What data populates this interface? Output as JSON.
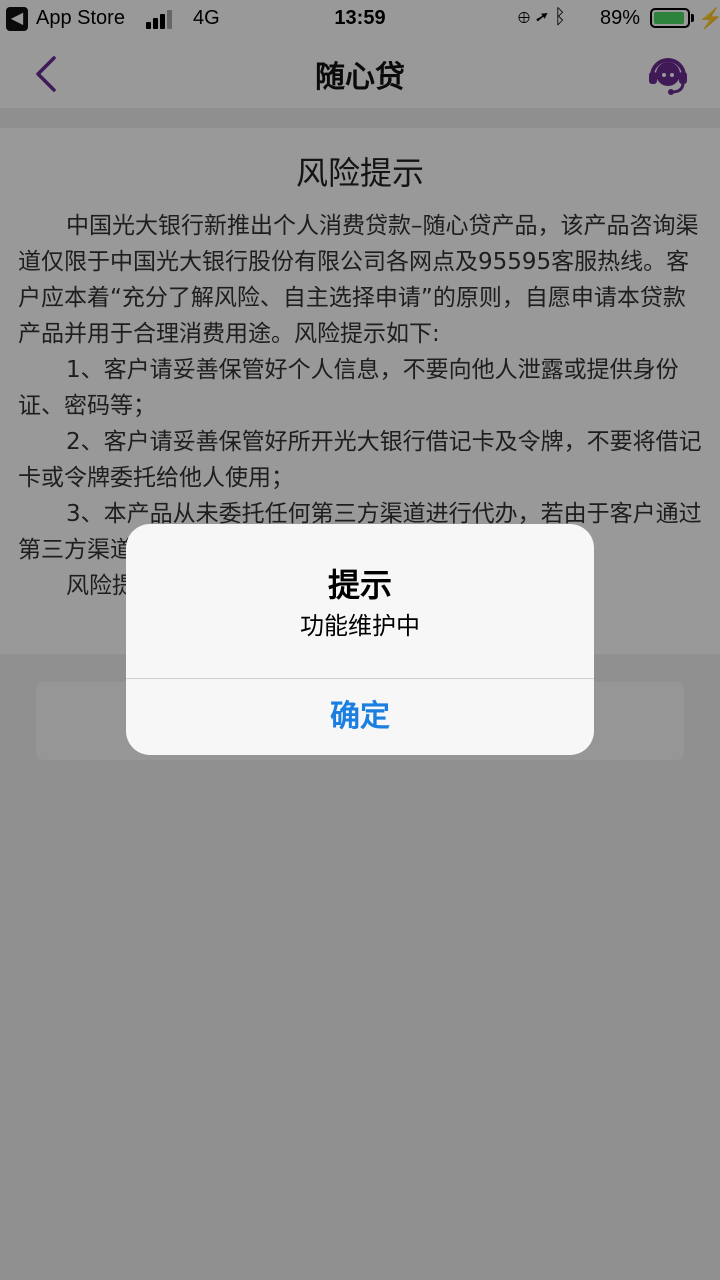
{
  "status_bar": {
    "back_app_label": "App Store",
    "network": "4G",
    "time": "13:59",
    "battery_percent": "89%",
    "battery_level": 0.89,
    "icons": [
      "orientation-lock-icon",
      "location-icon",
      "bluetooth-icon",
      "battery-icon",
      "charging-icon"
    ]
  },
  "nav": {
    "title": "随心贷",
    "accent_color": "#6b2c91"
  },
  "content": {
    "heading": "风险提示",
    "paragraphs": [
      "中国光大银行新推出个人消费贷款–随心贷产品，该产品咨询渠道仅限于中国光大银行股份有限公司各网点及95595客服热线。客户应本着“充分了解风险、自主选择申请”的原则，自愿申请本贷款产品并用于合理消费用途。风险提示如下:",
      "1、客户请妥善保管好个人信息，不要向他人泄露或提供身份证、密码等；",
      "2、客户请妥善保管好所开光大银行借记卡及令牌，不要将借记卡或令牌委托给他人使用；",
      "3、本产品从未委托任何第三方渠道进行代办，若由于客户通过第三方渠道办理产生的任何风险，由客户自行承担。",
      "风险提示"
    ]
  },
  "alert": {
    "title": "提示",
    "message": "功能维护中",
    "confirm_label": "确定",
    "confirm_color": "#1a7fe0"
  }
}
